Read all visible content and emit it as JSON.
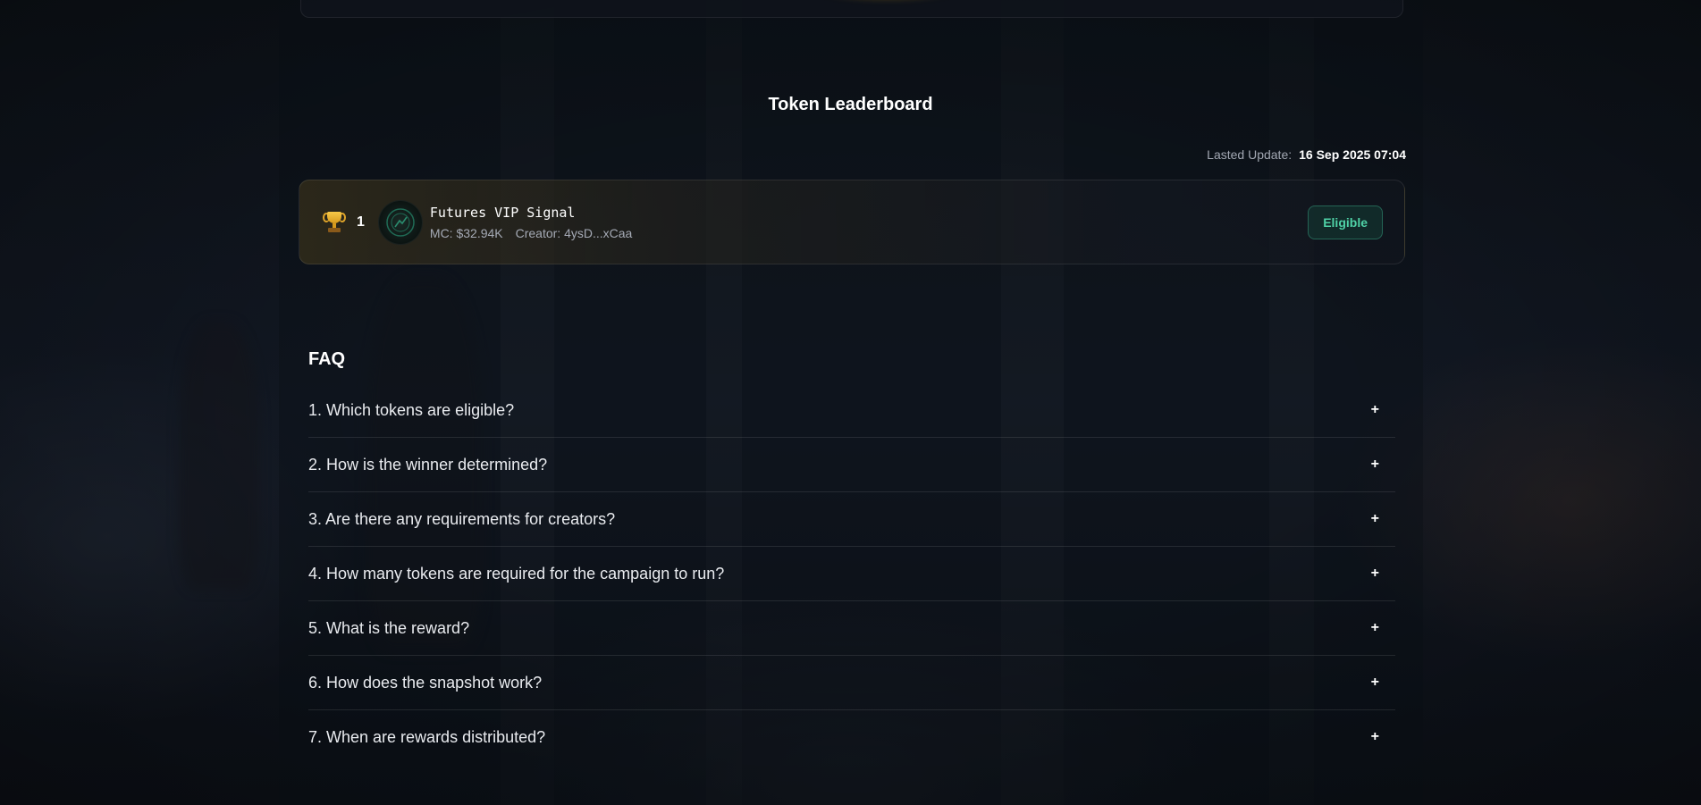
{
  "leaderboard": {
    "title": "Token Leaderboard",
    "last_update_label": "Lasted Update:",
    "last_update_value": "16 Sep 2025 07:04",
    "tokens": [
      {
        "rank": "1",
        "name": "Futures VIP Signal",
        "market_cap": "MC: $32.94K",
        "creator": "Creator: 4ysD...xCaa",
        "status": "Eligible",
        "icon": "trophy-icon"
      }
    ]
  },
  "faq": {
    "title": "FAQ",
    "expand_symbol": "+",
    "items": [
      {
        "question": "1. Which tokens are eligible?"
      },
      {
        "question": "2. How is the winner determined?"
      },
      {
        "question": "3. Are there any requirements for creators?"
      },
      {
        "question": "4. How many tokens are required for the campaign to run?"
      },
      {
        "question": "5. What is the reward?"
      },
      {
        "question": "6. How does the snapshot work?"
      },
      {
        "question": "7. When are rewards distributed?"
      }
    ]
  },
  "colors": {
    "background": "#0f131b",
    "accent_green": "#4fd1a6",
    "accent_gold": "#f7c948"
  }
}
